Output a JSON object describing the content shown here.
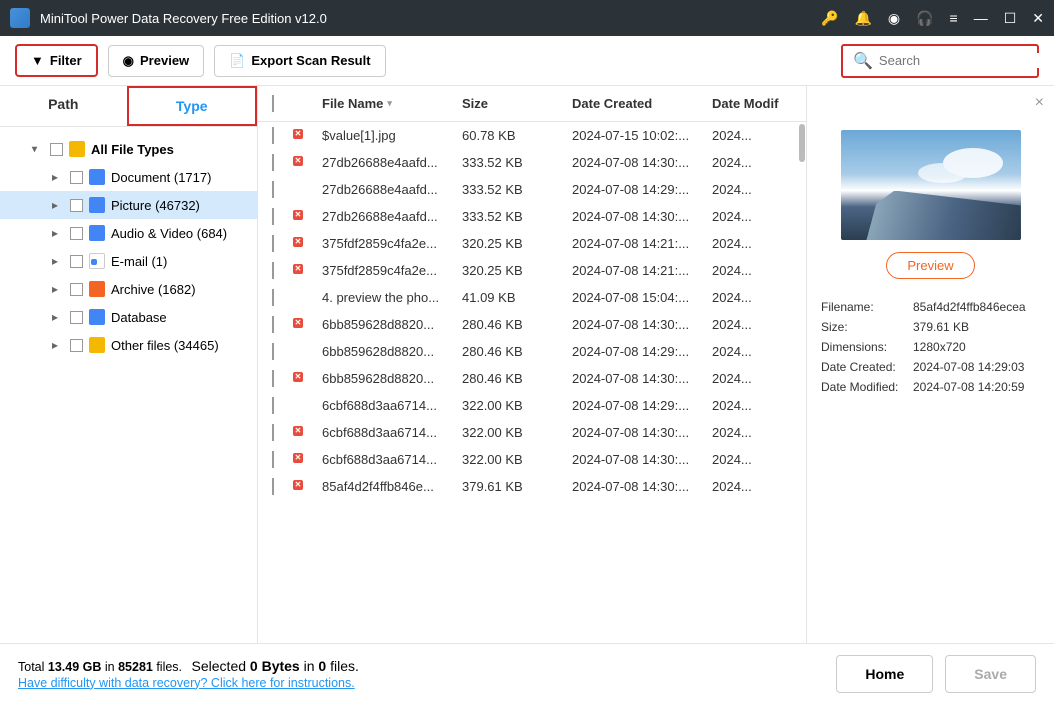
{
  "titlebar": {
    "title": "MiniTool Power Data Recovery Free Edition v12.0"
  },
  "toolbar": {
    "filter": "Filter",
    "preview": "Preview",
    "export": "Export Scan Result",
    "search_placeholder": "Search"
  },
  "tabs": {
    "path": "Path",
    "type": "Type"
  },
  "tree": {
    "root": "All File Types",
    "items": [
      {
        "label": "Document (1717)",
        "icon": "doc"
      },
      {
        "label": "Picture (46732)",
        "icon": "pic",
        "selected": true
      },
      {
        "label": "Audio & Video (684)",
        "icon": "av"
      },
      {
        "label": "E-mail (1)",
        "icon": "email"
      },
      {
        "label": "Archive (1682)",
        "icon": "archive"
      },
      {
        "label": "Database",
        "icon": "db"
      },
      {
        "label": "Other files (34465)",
        "icon": "other"
      }
    ]
  },
  "columns": {
    "name": "File Name",
    "size": "Size",
    "created": "Date Created",
    "modified": "Date Modif"
  },
  "files": [
    {
      "name": "$value[1].jpg",
      "size": "60.78 KB",
      "created": "2024-07-15 10:02:...",
      "modified": "2024...",
      "x": true
    },
    {
      "name": "27db26688e4aafd...",
      "size": "333.52 KB",
      "created": "2024-07-08 14:30:...",
      "modified": "2024...",
      "x": true
    },
    {
      "name": "27db26688e4aafd...",
      "size": "333.52 KB",
      "created": "2024-07-08 14:29:...",
      "modified": "2024...",
      "x": false
    },
    {
      "name": "27db26688e4aafd...",
      "size": "333.52 KB",
      "created": "2024-07-08 14:30:...",
      "modified": "2024...",
      "x": true
    },
    {
      "name": "375fdf2859c4fa2e...",
      "size": "320.25 KB",
      "created": "2024-07-08 14:21:...",
      "modified": "2024...",
      "x": true
    },
    {
      "name": "375fdf2859c4fa2e...",
      "size": "320.25 KB",
      "created": "2024-07-08 14:21:...",
      "modified": "2024...",
      "x": true
    },
    {
      "name": "4. preview the pho...",
      "size": "41.09 KB",
      "created": "2024-07-08 15:04:...",
      "modified": "2024...",
      "x": false
    },
    {
      "name": "6bb859628d8820...",
      "size": "280.46 KB",
      "created": "2024-07-08 14:30:...",
      "modified": "2024...",
      "x": true
    },
    {
      "name": "6bb859628d8820...",
      "size": "280.46 KB",
      "created": "2024-07-08 14:29:...",
      "modified": "2024...",
      "x": false
    },
    {
      "name": "6bb859628d8820...",
      "size": "280.46 KB",
      "created": "2024-07-08 14:30:...",
      "modified": "2024...",
      "x": true
    },
    {
      "name": "6cbf688d3aa6714...",
      "size": "322.00 KB",
      "created": "2024-07-08 14:29:...",
      "modified": "2024...",
      "x": false
    },
    {
      "name": "6cbf688d3aa6714...",
      "size": "322.00 KB",
      "created": "2024-07-08 14:30:...",
      "modified": "2024...",
      "x": true
    },
    {
      "name": "6cbf688d3aa6714...",
      "size": "322.00 KB",
      "created": "2024-07-08 14:30:...",
      "modified": "2024...",
      "x": true
    },
    {
      "name": "85af4d2f4ffb846e...",
      "size": "379.61 KB",
      "created": "2024-07-08 14:30:...",
      "modified": "2024...",
      "x": true
    }
  ],
  "preview": {
    "button": "Preview",
    "meta": {
      "filename_label": "Filename:",
      "filename": "85af4d2f4ffb846ecea",
      "size_label": "Size:",
      "size": "379.61 KB",
      "dimensions_label": "Dimensions:",
      "dimensions": "1280x720",
      "created_label": "Date Created:",
      "created": "2024-07-08 14:29:03",
      "modified_label": "Date Modified:",
      "modified": "2024-07-08 14:20:59"
    }
  },
  "footer": {
    "total_pre": "Total ",
    "total_size": "13.49 GB",
    "total_mid": " in ",
    "total_count": "85281",
    "total_post": " files.",
    "sel_pre": "Selected ",
    "sel_bytes": "0 Bytes",
    "sel_mid": " in ",
    "sel_count": "0",
    "sel_post": " files.",
    "link": "Have difficulty with data recovery? Click here for instructions.",
    "home": "Home",
    "save": "Save"
  }
}
